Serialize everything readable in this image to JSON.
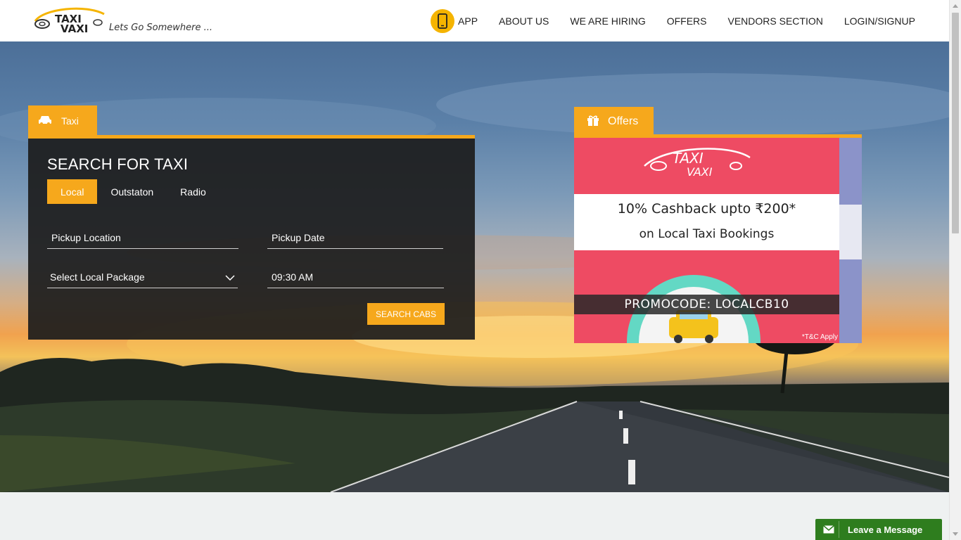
{
  "header": {
    "logo_text_top": "TAXI",
    "logo_text_bottom": "VAXI",
    "tagline": "Lets Go Somewhere ...",
    "nav": {
      "app": "APP",
      "about": "ABOUT US",
      "hiring": "WE ARE HIRING",
      "offers": "OFFERS",
      "vendors": "VENDORS SECTION",
      "login": "LOGIN/SIGNUP"
    }
  },
  "search": {
    "tab_label": "Taxi",
    "title": "SEARCH FOR TAXI",
    "tabs": [
      "Local",
      "Outstaton",
      "Radio"
    ],
    "active_tab": "Local",
    "pickup_location_placeholder": "Pickup Location",
    "pickup_date_placeholder": "Pickup Date",
    "package_select": "Select Local Package",
    "time_value": "09:30 AM",
    "search_button": "SEARCH CABS"
  },
  "offers": {
    "tab_label": "Offers",
    "logo_top": "TAXI",
    "logo_bottom": "VAXI",
    "line1": "10% Cashback upto ₹200*",
    "line2": "on Local Taxi Bookings",
    "promocode": "PROMOCODE: LOCALCB10",
    "tnc": "*T&C Apply"
  },
  "chat": {
    "label": "Leave a Message"
  },
  "colors": {
    "accent": "#f6a81c",
    "panel": "#1c1c1c",
    "offer_pink": "#ee4b63",
    "chat_green": "#2e7d1e"
  }
}
